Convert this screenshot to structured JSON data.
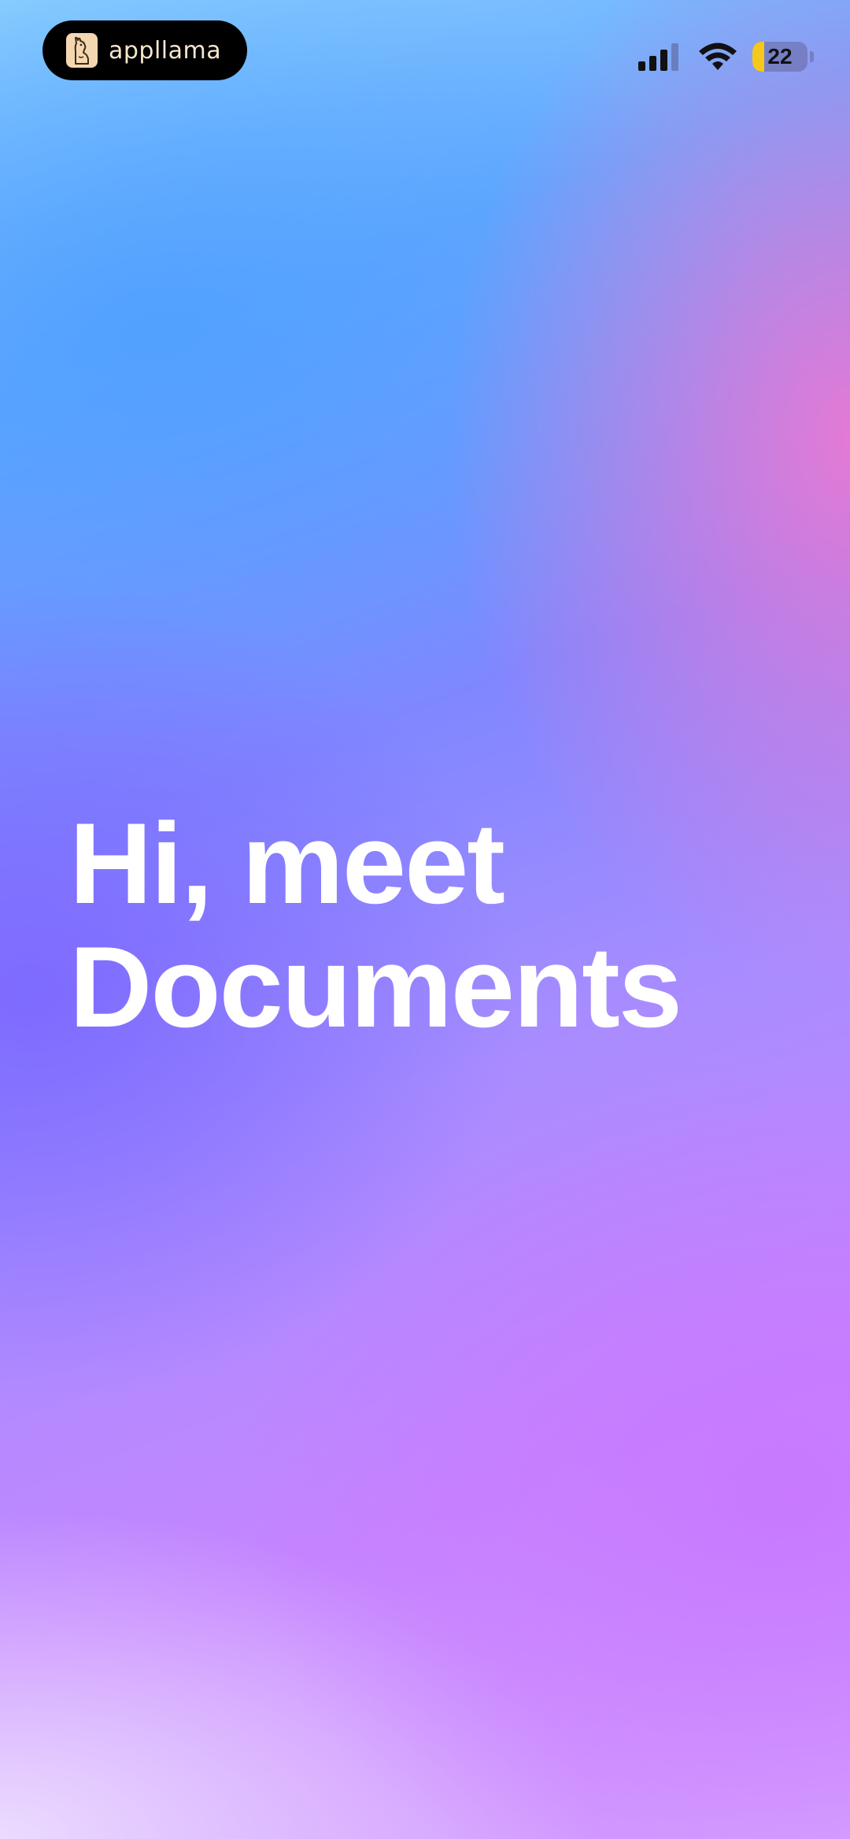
{
  "app_badge": {
    "name": "appllama",
    "icon": "llama-icon"
  },
  "status_bar": {
    "signal_icon": "cellular-signal-icon",
    "signal_bars_active": 3,
    "signal_bars_total": 4,
    "wifi_icon": "wifi-icon",
    "battery_level": "22",
    "battery_fraction": 0.22,
    "battery_color": "#f6c81b"
  },
  "onboarding": {
    "headline_line1": "Hi, meet",
    "headline_line2": "Documents"
  }
}
